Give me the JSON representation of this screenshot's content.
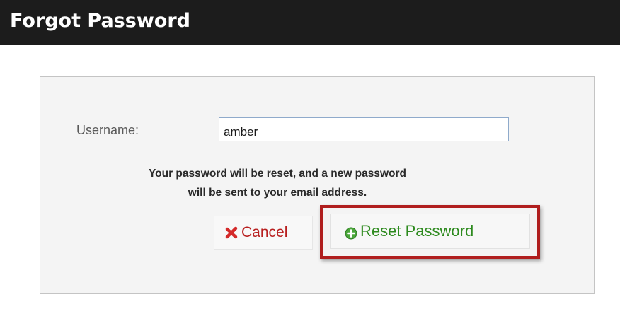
{
  "header": {
    "title": "Forgot Password"
  },
  "form": {
    "username_label": "Username:",
    "username_value": "amber",
    "info_line1": "Your password will be reset, and a new password",
    "info_line2": "will be sent to your email address."
  },
  "buttons": {
    "cancel_label": "Cancel",
    "cancel_icon": "close-x-icon",
    "reset_label": "Reset Password",
    "reset_icon": "plus-circle-icon"
  },
  "colors": {
    "header_bg": "#1c1c1c",
    "cancel_text": "#b81f1f",
    "reset_text": "#2d8a1e",
    "highlight_border": "#b01e1e"
  }
}
